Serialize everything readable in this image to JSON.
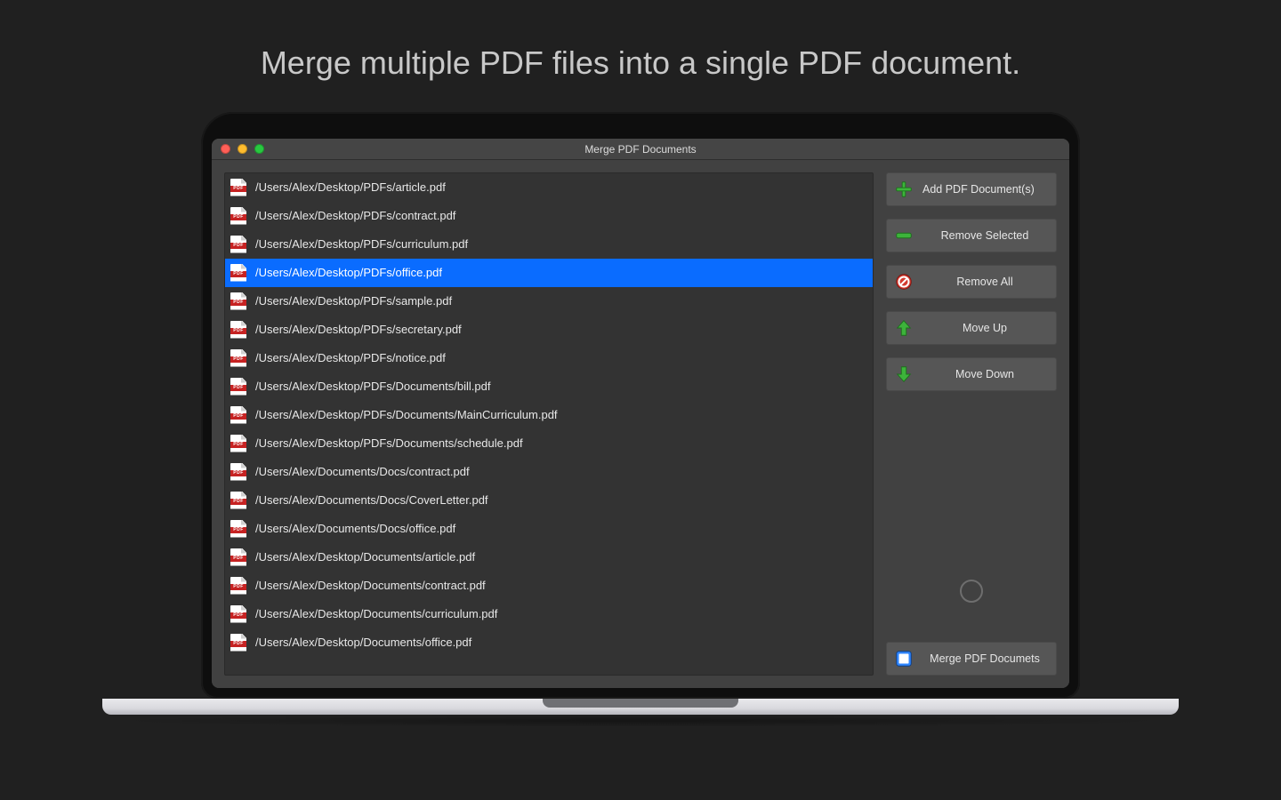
{
  "tagline": "Merge multiple PDF files into a single PDF document.",
  "window_title": "Merge PDF Documents",
  "files": [
    {
      "path": "/Users/Alex/Desktop/PDFs/article.pdf",
      "selected": false
    },
    {
      "path": "/Users/Alex/Desktop/PDFs/contract.pdf",
      "selected": false
    },
    {
      "path": "/Users/Alex/Desktop/PDFs/curriculum.pdf",
      "selected": false
    },
    {
      "path": "/Users/Alex/Desktop/PDFs/office.pdf",
      "selected": true
    },
    {
      "path": "/Users/Alex/Desktop/PDFs/sample.pdf",
      "selected": false
    },
    {
      "path": "/Users/Alex/Desktop/PDFs/secretary.pdf",
      "selected": false
    },
    {
      "path": "/Users/Alex/Desktop/PDFs/notice.pdf",
      "selected": false
    },
    {
      "path": "/Users/Alex/Desktop/PDFs/Documents/bill.pdf",
      "selected": false
    },
    {
      "path": "/Users/Alex/Desktop/PDFs/Documents/MainCurriculum.pdf",
      "selected": false
    },
    {
      "path": "/Users/Alex/Desktop/PDFs/Documents/schedule.pdf",
      "selected": false
    },
    {
      "path": "/Users/Alex/Documents/Docs/contract.pdf",
      "selected": false
    },
    {
      "path": "/Users/Alex/Documents/Docs/CoverLetter.pdf",
      "selected": false
    },
    {
      "path": "/Users/Alex/Documents/Docs/office.pdf",
      "selected": false
    },
    {
      "path": "/Users/Alex/Desktop/Documents/article.pdf",
      "selected": false
    },
    {
      "path": "/Users/Alex/Desktop/Documents/contract.pdf",
      "selected": false
    },
    {
      "path": "/Users/Alex/Desktop/Documents/curriculum.pdf",
      "selected": false
    },
    {
      "path": "/Users/Alex/Desktop/Documents/office.pdf",
      "selected": false
    }
  ],
  "sidebar": {
    "add_label": "Add PDF Document(s)",
    "remove_sel_label": "Remove Selected",
    "remove_all_label": "Remove All",
    "move_up_label": "Move Up",
    "move_down_label": "Move Down",
    "merge_label": "Merge PDF Documets"
  },
  "pdf_icon_text": "PDF"
}
